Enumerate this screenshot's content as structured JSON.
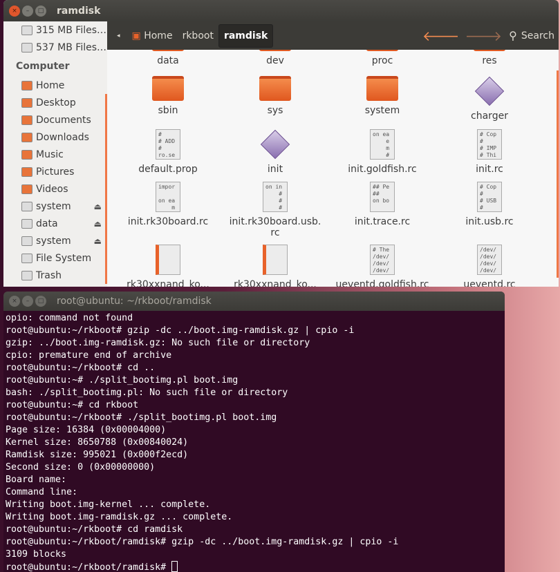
{
  "file_manager": {
    "title": "ramdisk",
    "sidebar": {
      "devices": [
        "315 MB Files…",
        "537 MB Files…"
      ],
      "heading": "Computer",
      "items": [
        {
          "label": "Home",
          "icon": "home-folder-icon"
        },
        {
          "label": "Desktop",
          "icon": "desktop-icon"
        },
        {
          "label": "Documents",
          "icon": "documents-folder-icon"
        },
        {
          "label": "Downloads",
          "icon": "downloads-folder-icon"
        },
        {
          "label": "Music",
          "icon": "music-folder-icon"
        },
        {
          "label": "Pictures",
          "icon": "pictures-folder-icon"
        },
        {
          "label": "Videos",
          "icon": "videos-folder-icon"
        },
        {
          "label": "system",
          "icon": "drive-icon",
          "eject": true
        },
        {
          "label": "data",
          "icon": "drive-icon",
          "eject": true
        },
        {
          "label": "system",
          "icon": "drive-icon",
          "eject": true
        },
        {
          "label": "File System",
          "icon": "filesystem-icon"
        },
        {
          "label": "Trash",
          "icon": "trash-icon"
        }
      ]
    },
    "toolbar": {
      "crumbs": [
        "Home",
        "rkboot",
        "ramdisk"
      ],
      "search": "Search"
    },
    "files": [
      {
        "name": "data",
        "type": "folder"
      },
      {
        "name": "dev",
        "type": "folder"
      },
      {
        "name": "proc",
        "type": "folder"
      },
      {
        "name": "res",
        "type": "folder"
      },
      {
        "name": "sbin",
        "type": "folder"
      },
      {
        "name": "sys",
        "type": "folder"
      },
      {
        "name": "system",
        "type": "folder"
      },
      {
        "name": "charger",
        "type": "exec"
      },
      {
        "name": "default.prop",
        "type": "text",
        "preview": "#\n# ADD\n#\nro.se"
      },
      {
        "name": "init",
        "type": "exec"
      },
      {
        "name": "init.goldfish.rc",
        "type": "text",
        "preview": "on ea\n    e\n    m\n    #"
      },
      {
        "name": "init.rc",
        "type": "text",
        "preview": "# Cop\n#\n# IMP\n# Thi"
      },
      {
        "name": "init.rk30board.rc",
        "type": "text",
        "preview": "impor\n\non ea\n    m"
      },
      {
        "name": "init.rk30board.usb.\nrc",
        "type": "text",
        "preview": "on in\n    #\n    #\n    #"
      },
      {
        "name": "init.trace.rc",
        "type": "text",
        "preview": "## Pe\n##\non bo"
      },
      {
        "name": "init.usb.rc",
        "type": "text",
        "preview": "# Cop\n#\n# USB\n#"
      },
      {
        "name": "rk30xxnand_ko...",
        "type": "binary"
      },
      {
        "name": "rk30xxnand_ko...",
        "type": "binary"
      },
      {
        "name": "ueventd.goldfish.rc",
        "type": "text",
        "preview": "# The\n/dev/\n/dev/\n/dev/"
      },
      {
        "name": "ueventd.rc",
        "type": "text",
        "preview": "/dev/\n/dev/\n/dev/\n/dev/"
      }
    ]
  },
  "terminal": {
    "title": "root@ubuntu: ~/rkboot/ramdisk",
    "lines": [
      "opio: command not found",
      "root@ubuntu:~/rkboot# gzip -dc ../boot.img-ramdisk.gz | cpio -i",
      "gzip: ../boot.img-ramdisk.gz: No such file or directory",
      "cpio: premature end of archive",
      "root@ubuntu:~/rkboot# cd ..",
      "root@ubuntu:~# ./split_bootimg.pl boot.img",
      "bash: ./split_bootimg.pl: No such file or directory",
      "root@ubuntu:~# cd rkboot",
      "root@ubuntu:~/rkboot# ./split_bootimg.pl boot.img",
      "Page size: 16384 (0x00004000)",
      "Kernel size: 8650788 (0x00840024)",
      "Ramdisk size: 995021 (0x000f2ecd)",
      "Second size: 0 (0x00000000)",
      "Board name:",
      "Command line:",
      "Writing boot.img-kernel ... complete.",
      "Writing boot.img-ramdisk.gz ... complete.",
      "root@ubuntu:~/rkboot# cd ramdisk",
      "root@ubuntu:~/rkboot/ramdisk# gzip -dc ../boot.img-ramdisk.gz | cpio -i",
      "3109 blocks"
    ],
    "prompt": "root@ubuntu:~/rkboot/ramdisk# "
  }
}
